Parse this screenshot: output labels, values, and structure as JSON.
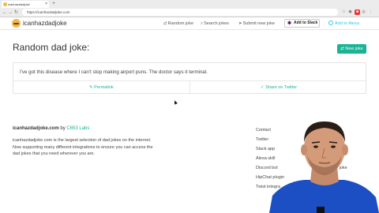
{
  "browser": {
    "tab_title": "icanhazdadjoke",
    "url": "https://icanhazdadjoke.com"
  },
  "header": {
    "brand": "icanhazdadjoke",
    "nav": [
      {
        "label": "Random joke",
        "icon": "shuffle-icon"
      },
      {
        "label": "Search jokes",
        "icon": "search-icon"
      },
      {
        "label": "Submit new joke",
        "icon": "send-icon"
      }
    ],
    "slack_button": "Add to Slack",
    "alexa_link": "Add to Alexa"
  },
  "main": {
    "title": "Random dad joke:",
    "new_joke_button": "New joke",
    "joke": "I've got this disease where I can't stop making airport puns. The doctor says it terminal.",
    "permalink": "Permalink",
    "share": "Share on Twitter"
  },
  "footer": {
    "site": "icanhazdadjoke.com",
    "by": "by",
    "lab": "C653 Labs",
    "description": "icanhazdadjoke.com is the largest selection of dad jokes on the internet. Now supporting many different integrations to ensure you can access the dad jokes that you need wherever you are.",
    "links": [
      "Contact",
      "Twitter",
      "Slack app",
      "Alexa skill",
      "Discord bot",
      "HipChat plugin",
      "Twist integra"
    ],
    "links_right": [
      "e",
      "new joke"
    ]
  },
  "colors": {
    "accent": "#1ab394",
    "brand_yellow": "#f2b84b",
    "alexa": "#31c4f3"
  }
}
